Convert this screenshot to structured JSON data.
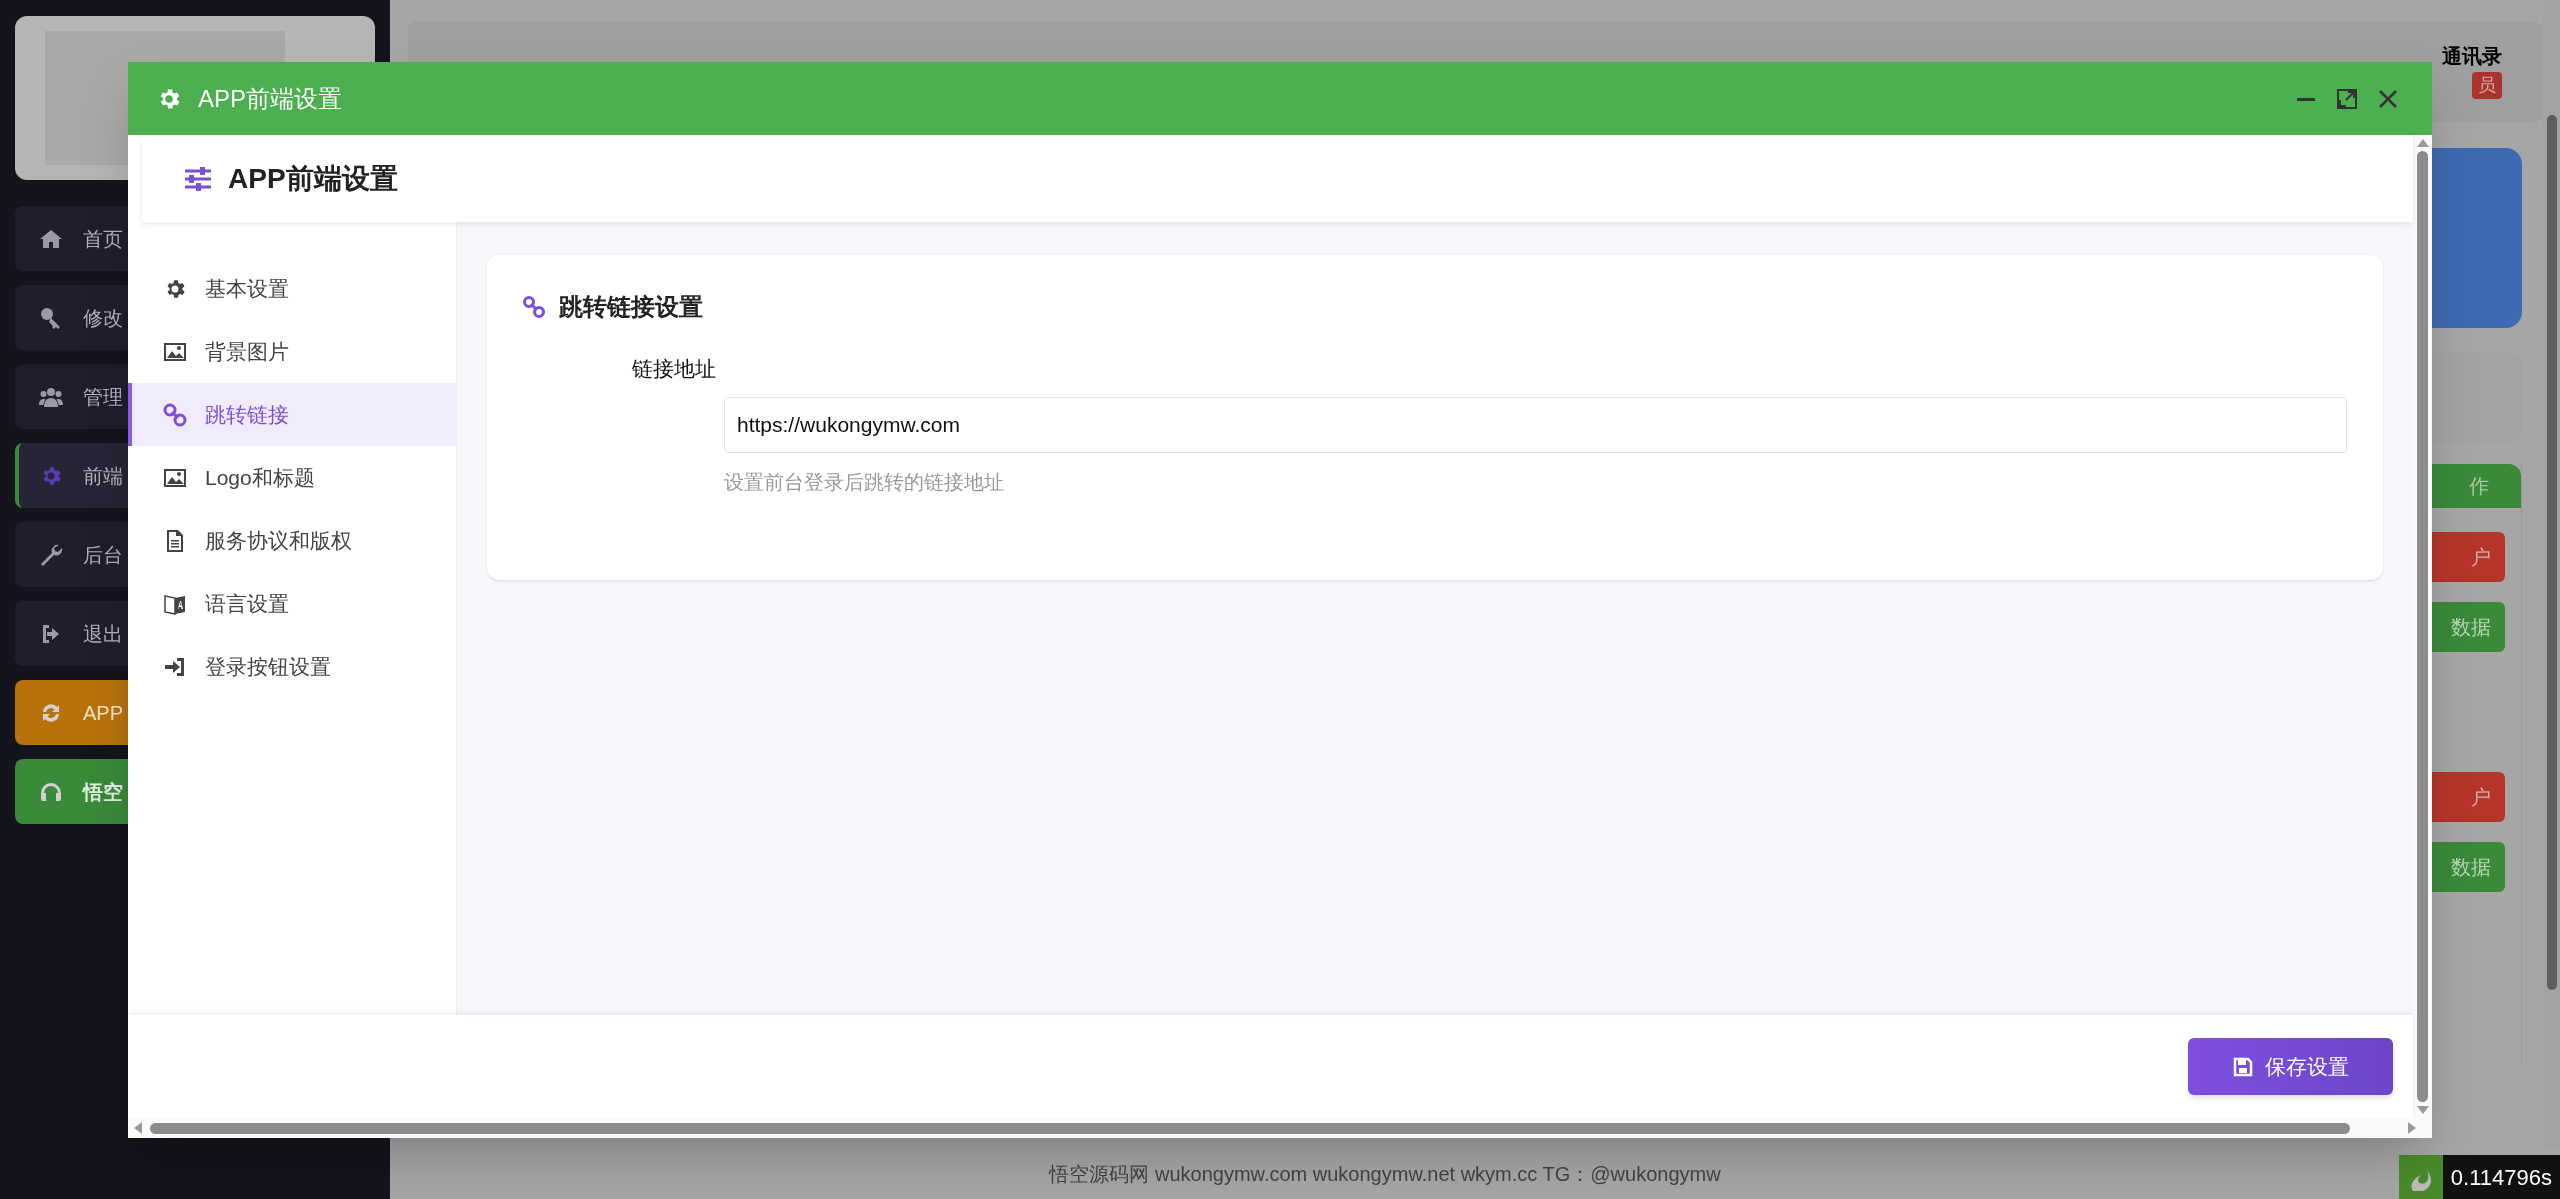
{
  "background": {
    "sidebar": [
      {
        "label": "首页",
        "kind": "normal",
        "selected": false
      },
      {
        "label": "修改",
        "kind": "normal",
        "selected": false
      },
      {
        "label": "管理",
        "kind": "normal",
        "selected": false
      },
      {
        "label": "前端",
        "kind": "normal",
        "selected": true
      },
      {
        "label": "后台",
        "kind": "normal",
        "selected": false
      },
      {
        "label": "退出",
        "kind": "normal",
        "selected": false
      },
      {
        "label": "APP",
        "kind": "orange",
        "selected": false
      },
      {
        "label": "悟空",
        "kind": "green",
        "selected": false
      }
    ],
    "top_bar": {
      "user_label": "通讯录",
      "badge": "员"
    },
    "right_panel": {
      "header": "作",
      "buttons": [
        {
          "label": "户",
          "kind": "danger"
        },
        {
          "label": "数据",
          "kind": "success"
        },
        {
          "label": "户",
          "kind": "danger"
        },
        {
          "label": "数据",
          "kind": "success"
        }
      ]
    },
    "footer": "悟空源码网 wukongymw.com wukongymw.net wkym.cc TG：@wukongymw",
    "timer": "0.114796s"
  },
  "dialog": {
    "title": "APP前端设置",
    "page_title": "APP前端设置",
    "menu": [
      {
        "label": "基本设置",
        "selected": false
      },
      {
        "label": "背景图片",
        "selected": false
      },
      {
        "label": "跳转链接",
        "selected": true
      },
      {
        "label": "Logo和标题",
        "selected": false
      },
      {
        "label": "服务协议和版权",
        "selected": false
      },
      {
        "label": "语言设置",
        "selected": false
      },
      {
        "label": "登录按钮设置",
        "selected": false
      }
    ],
    "section": {
      "title": "跳转链接设置",
      "field": {
        "label": "链接地址",
        "value": "https://wukongymw.com",
        "help": "设置前台登录后跳转的链接地址"
      }
    },
    "save_button": "保存设置"
  }
}
